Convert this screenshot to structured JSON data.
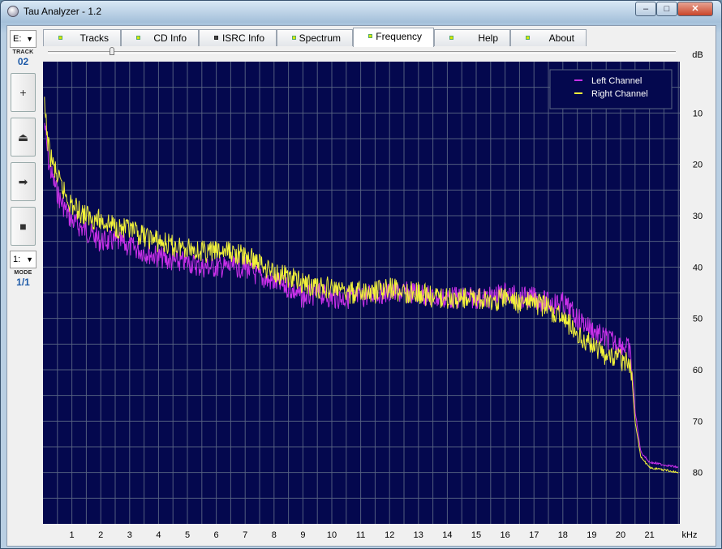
{
  "window": {
    "title": "Tau Analyzer - 1.2",
    "min": "–",
    "max": "□",
    "close": "✕"
  },
  "sidebar": {
    "drive": "E:",
    "track_label": "TRACK",
    "track_value": "02",
    "buttons": [
      {
        "name": "add-button",
        "icon": "+"
      },
      {
        "name": "eject-button",
        "icon": "⏏"
      },
      {
        "name": "play-button",
        "icon": "➡"
      },
      {
        "name": "stop-button",
        "icon": "■"
      }
    ],
    "mode_select": "1:",
    "mode_label": "MODE",
    "mode_value": "1/1"
  },
  "tabs": [
    {
      "label": "Tracks",
      "led": "yellow"
    },
    {
      "label": "CD Info",
      "led": "yellow"
    },
    {
      "label": "ISRC Info",
      "led": "dark"
    },
    {
      "label": "Spectrum",
      "led": "yellow"
    },
    {
      "label": "Frequency",
      "led": "yellow",
      "active": true
    },
    {
      "label": "Help",
      "led": "yellow"
    },
    {
      "label": "About",
      "led": "yellow"
    }
  ],
  "chart_data": {
    "type": "line",
    "xlabel": "kHz",
    "ylabel": "dB",
    "xlim": [
      0,
      22.05
    ],
    "ylim": [
      0,
      90
    ],
    "y_inverted": true,
    "x_ticks": [
      1,
      2,
      3,
      4,
      5,
      6,
      7,
      8,
      9,
      10,
      11,
      12,
      13,
      14,
      15,
      16,
      17,
      18,
      19,
      20,
      21
    ],
    "y_ticks": [
      10,
      20,
      30,
      40,
      50,
      60,
      70,
      80
    ],
    "grid": true,
    "legend_position": "top-right",
    "colors": {
      "background": "#04084e",
      "grid": "#5a6684",
      "left": "#c830e8",
      "right": "#f2f23a"
    },
    "series": [
      {
        "name": "Left Channel",
        "x": [
          0.05,
          0.2,
          0.4,
          0.6,
          0.8,
          1,
          1.5,
          2,
          2.5,
          3,
          3.5,
          4,
          4.5,
          5,
          5.5,
          6,
          6.5,
          7,
          7.5,
          8,
          8.5,
          9,
          9.5,
          10,
          10.5,
          11,
          11.5,
          12,
          12.5,
          13,
          13.5,
          14,
          14.5,
          15,
          15.5,
          16,
          16.5,
          17,
          17.5,
          18,
          18.2,
          18.5,
          19,
          19.2,
          19.5,
          20,
          20.3,
          20.4,
          20.5,
          20.7,
          21,
          22
        ],
        "y": [
          12,
          20,
          24,
          27,
          29,
          31,
          33,
          35,
          35,
          36,
          37,
          38,
          39,
          39,
          40,
          40,
          40,
          40,
          42,
          43,
          44,
          46,
          45,
          46,
          46,
          46,
          45,
          45,
          45,
          45,
          46,
          46,
          46,
          46,
          46,
          45,
          46,
          46,
          47,
          47,
          48,
          50,
          52,
          53,
          54,
          55,
          56,
          60,
          68,
          76,
          78,
          79
        ]
      },
      {
        "name": "Right Channel",
        "x": [
          0.05,
          0.2,
          0.4,
          0.6,
          0.8,
          1,
          1.5,
          2,
          2.5,
          3,
          3.5,
          4,
          4.5,
          5,
          5.5,
          6,
          6.5,
          7,
          7.5,
          8,
          8.5,
          9,
          9.5,
          10,
          10.5,
          11,
          11.5,
          12,
          12.5,
          13,
          13.5,
          14,
          14.5,
          15,
          15.5,
          16,
          16.5,
          17,
          17.5,
          18,
          18.2,
          18.5,
          19,
          19.2,
          19.5,
          20,
          20.3,
          20.4,
          20.5,
          20.7,
          21,
          22
        ],
        "y": [
          9,
          17,
          21,
          24,
          26,
          28,
          30,
          31,
          32,
          33,
          34,
          35,
          36,
          36,
          37,
          37,
          37,
          38,
          39,
          41,
          42,
          43,
          44,
          44,
          45,
          45,
          45,
          44,
          45,
          45,
          46,
          46,
          46,
          46,
          47,
          46,
          47,
          47,
          48,
          50,
          51,
          53,
          55,
          56,
          57,
          58,
          59,
          62,
          70,
          77,
          79,
          80
        ]
      }
    ]
  }
}
